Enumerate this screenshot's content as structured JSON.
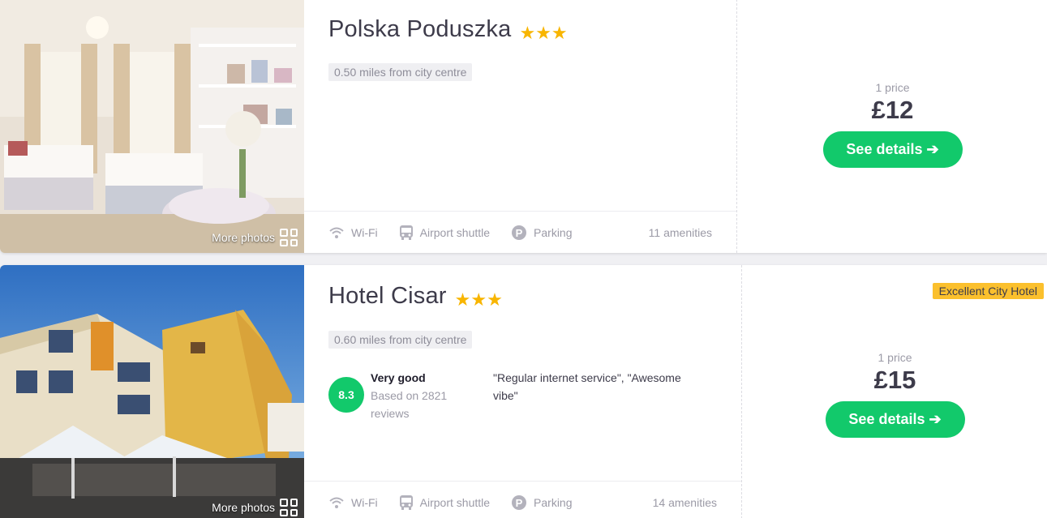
{
  "hotels": [
    {
      "name": "Polska Poduszka",
      "stars": "★★★",
      "distance": "0.50 miles from city centre",
      "more_photos": "More photos",
      "amenities": [
        {
          "icon": "wifi-icon",
          "label": "Wi-Fi"
        },
        {
          "icon": "bus-icon",
          "label": "Airport shuttle"
        },
        {
          "icon": "parking-icon",
          "label": "Parking"
        }
      ],
      "amenity_count": "11 amenities",
      "price_label": "1 price",
      "price": "£12",
      "cta": "See details ➔"
    },
    {
      "name": "Hotel Cisar",
      "stars": "★★★",
      "distance": "0.60 miles from city centre",
      "more_photos": "More photos",
      "rating": {
        "score": "8.3",
        "word": "Very good",
        "reviews": "Based on 2821 reviews"
      },
      "quote": "\"Regular internet service\", \"Awesome vibe\"",
      "amenities": [
        {
          "icon": "wifi-icon",
          "label": "Wi-Fi"
        },
        {
          "icon": "bus-icon",
          "label": "Airport shuttle"
        },
        {
          "icon": "parking-icon",
          "label": "Parking"
        }
      ],
      "amenity_count": "14 amenities",
      "badge": "Excellent City Hotel",
      "price_label": "1 price",
      "price": "£15",
      "cta": "See details ➔"
    }
  ],
  "colors": {
    "accent_green": "#12c96b",
    "star_yellow": "#f8b500",
    "badge_yellow": "#fbc02d"
  }
}
